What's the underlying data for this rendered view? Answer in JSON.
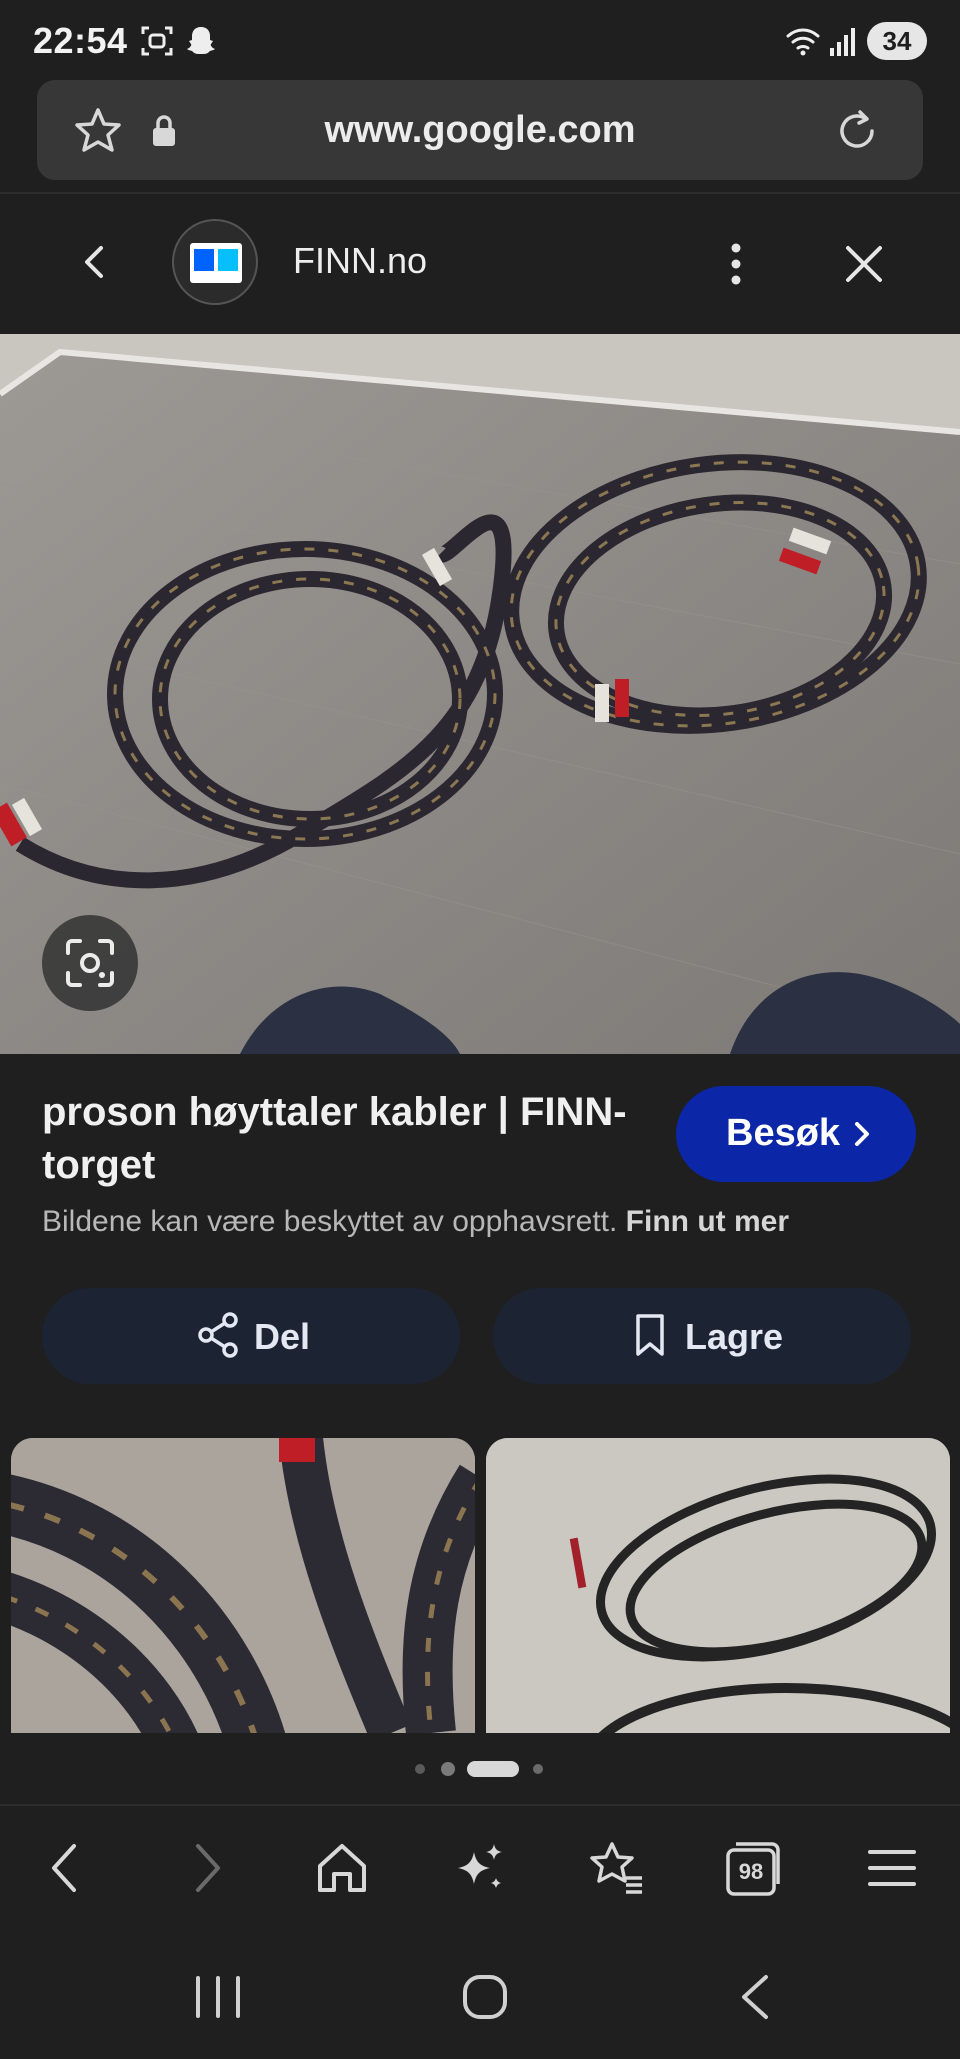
{
  "status_bar": {
    "time": "22:54",
    "battery": "34"
  },
  "address_bar": {
    "url": "www.google.com"
  },
  "site_header": {
    "site_name": "FINN.no"
  },
  "result": {
    "title": "proson høyttaler kabler | FINN-torget",
    "visit_label": "Besøk",
    "copyright_text": "Bildene kan være beskyttet av opphavsrett.",
    "copyright_link": "Finn ut mer"
  },
  "actions": {
    "share_label": "Del",
    "save_label": "Lagre"
  },
  "toolbar": {
    "tabs_count": "98"
  },
  "colors": {
    "background": "#1f1f1f",
    "address_bar": "#373737",
    "visit_button": "#0b27a8",
    "action_button": "#1c2433",
    "text_primary": "#f0f0f0",
    "text_secondary": "#b8b8b8"
  },
  "icons": [
    "qr-scan-icon",
    "snapchat-icon",
    "wifi-icon",
    "signal-icon",
    "star-icon",
    "lock-icon",
    "reload-icon",
    "back-chevron-icon",
    "more-vert-icon",
    "close-icon",
    "lens-icon",
    "chevron-right-icon",
    "share-icon",
    "bookmark-icon",
    "back-icon",
    "forward-icon",
    "home-icon",
    "sparkle-icon",
    "bookmarks-icon",
    "tabs-icon",
    "menu-icon",
    "recents-icon",
    "home-circle-icon",
    "system-back-icon"
  ]
}
